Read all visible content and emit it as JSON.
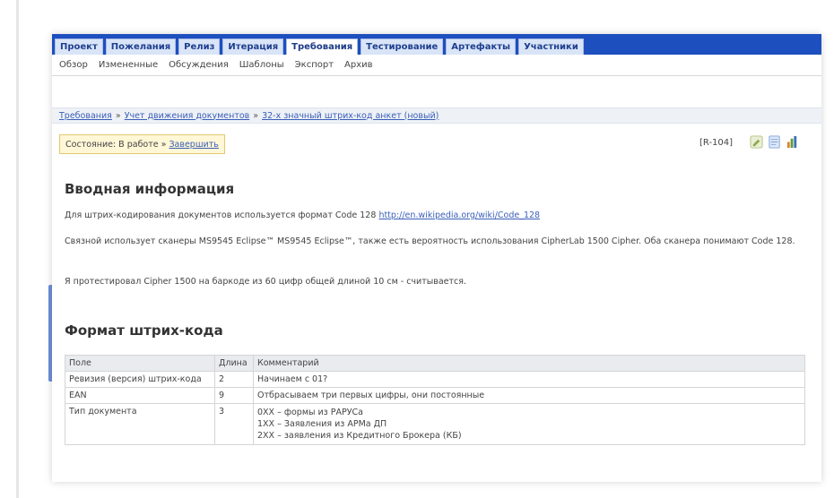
{
  "nav": {
    "tabs": [
      {
        "label": "Проект",
        "active": false
      },
      {
        "label": "Пожелания",
        "active": false
      },
      {
        "label": "Релиз",
        "active": false
      },
      {
        "label": "Итерация",
        "active": false
      },
      {
        "label": "Требования",
        "active": true
      },
      {
        "label": "Тестирование",
        "active": false
      },
      {
        "label": "Артефакты",
        "active": false
      },
      {
        "label": "Участники",
        "active": false
      }
    ],
    "subtabs": [
      "Обзор",
      "Измененные",
      "Обсуждения",
      "Шаблоны",
      "Экспорт",
      "Архив"
    ]
  },
  "breadcrumb": {
    "items": [
      "Требования",
      "Учет движения документов",
      "32-х значный штрих-код анкет (новый)"
    ],
    "separator": "»"
  },
  "status": {
    "text": "Состояние: В работе »",
    "action": "Завершить"
  },
  "item_id": "[R-104]",
  "toolbar_icons": [
    "edit-icon",
    "document-icon",
    "chart-icon"
  ],
  "sections": {
    "intro_title": "Вводная информация",
    "intro_p1": "Для штрих-кодирования документов используется формат Code 128",
    "intro_p1_link": "http://en.wikipedia.org/wiki/Code_128",
    "intro_p2": "Связной использует сканеры MS9545 Eclipse™ MS9545 Eclipse™, также есть вероятность использования CipherLab 1500 Cipher. Оба сканера понимают Code 128.",
    "intro_p3": "Я протестировал Cipher 1500 на баркоде из 60 цифр общей длиной 10 см - считывается.",
    "format_title": "Формат штрих-кода"
  },
  "table": {
    "headers": [
      "Поле",
      "Длина",
      "Комментарий"
    ],
    "rows": [
      {
        "field": "Ревизия (версия) штрих-кода",
        "length": "2",
        "comment": [
          "Начинаем с 01?"
        ]
      },
      {
        "field": "EAN",
        "length": "9",
        "comment": [
          "Отбрасываем три первых цифры, они постоянные"
        ]
      },
      {
        "field": "Тип документа",
        "length": "3",
        "comment": [
          "0XX – формы из РАРУСа",
          "1XX – Заявления из АРМа ДП",
          "2XX – заявления из Кредитного Брокера (КБ)"
        ]
      }
    ]
  },
  "colors": {
    "nav_bar": "#1e4fbf",
    "link": "#3a5fb8",
    "status_bg": "#fff7d6",
    "side_tab": "#6f8fd8"
  }
}
